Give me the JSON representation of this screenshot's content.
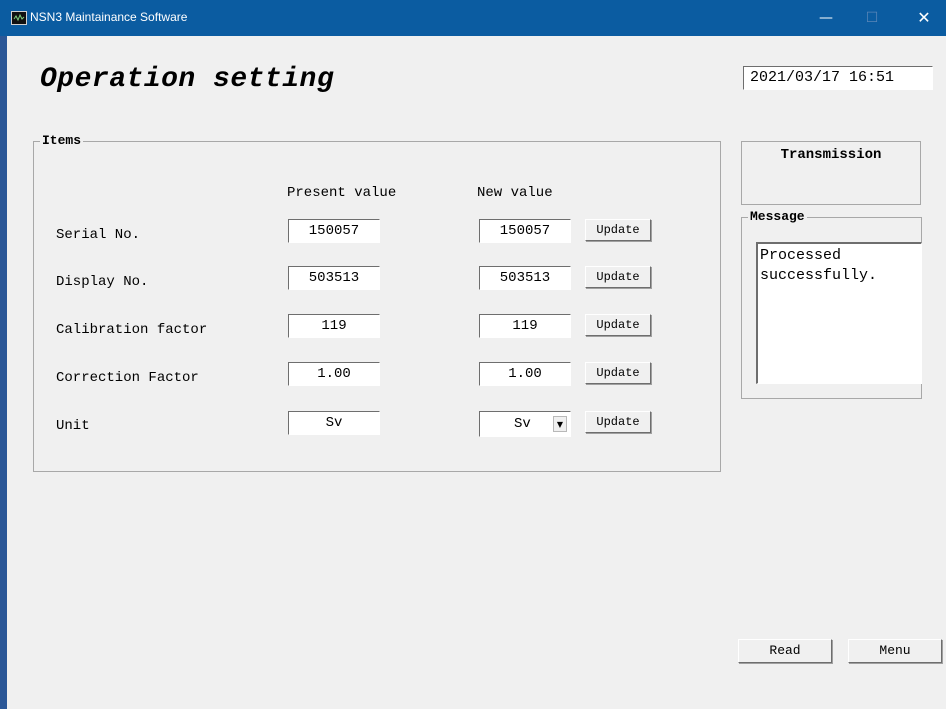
{
  "window": {
    "title": "NSN3 Maintainance Software",
    "minimize_glyph": "—",
    "maximize_glyph": "☐",
    "close_glyph": "✕"
  },
  "page_title": "Operation setting",
  "datetime": "2021/03/17 16:51",
  "items": {
    "label": "Items",
    "present_header": "Present value",
    "new_header": "New value",
    "update_label": "Update",
    "rows": [
      {
        "label": "Serial No.",
        "present": "150057",
        "new": "150057"
      },
      {
        "label": "Display No.",
        "present": "503513",
        "new": "503513"
      },
      {
        "label": "Calibration factor",
        "present": "119",
        "new": "119"
      },
      {
        "label": "Correction Factor",
        "present": "1.00",
        "new": "1.00"
      },
      {
        "label": "Unit",
        "present": "Sv",
        "new": "Sv"
      }
    ]
  },
  "transmission_label": "Transmission",
  "message": {
    "label": "Message",
    "text": "Processed\nsuccessfully."
  },
  "buttons": {
    "read": "Read",
    "menu": "Menu"
  },
  "icons": {
    "app": "monitor-wave-icon",
    "dropdown": "chevron-down-icon"
  }
}
